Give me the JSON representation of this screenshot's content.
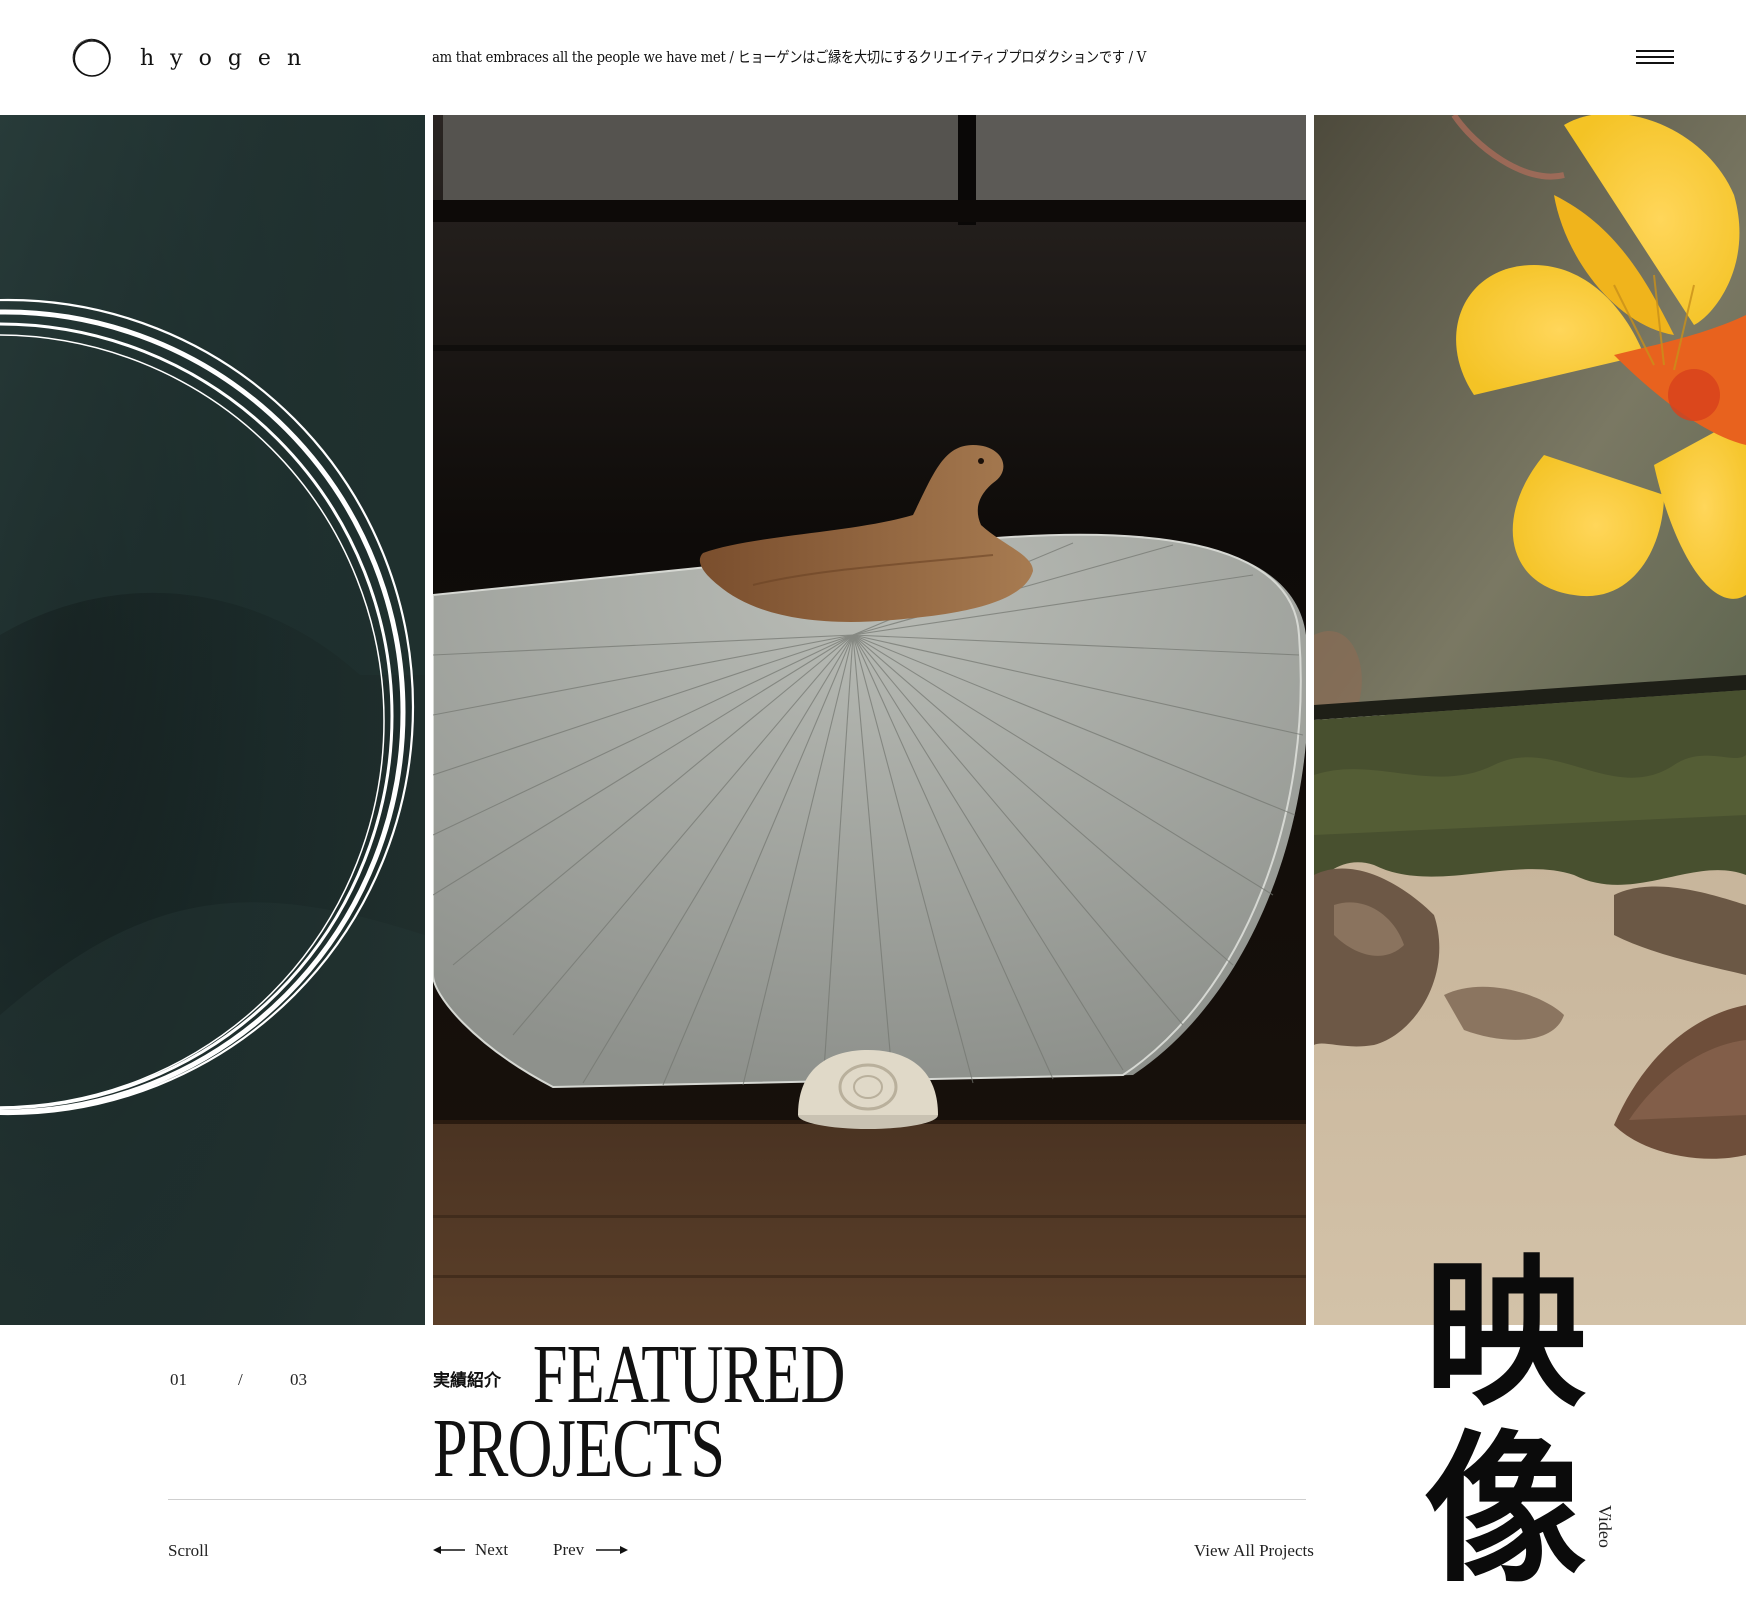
{
  "brand": {
    "name": "hyogen",
    "logo_icon": "ring-icon"
  },
  "ticker": {
    "text": "am that embraces all the people we have met / ヒョーゲンはご縁を大切にするクリエイティブプロダクションです / V"
  },
  "header": {
    "menu_icon": "hamburger-icon"
  },
  "slides": [
    {
      "name": "ring-slide",
      "bg": "#1b2a29"
    },
    {
      "name": "uchiwa-fan-slide",
      "bg": "#14100d"
    },
    {
      "name": "flower-beach-slide",
      "bg": "#6b6a55"
    }
  ],
  "pagination": {
    "current": "01",
    "separator": "/",
    "total": "03"
  },
  "section": {
    "label_ja": "実績紹介",
    "title_line1": "FEATURED",
    "title_line2": "PROJECTS"
  },
  "controls": {
    "scroll_label": "Scroll",
    "next_label": "Next",
    "prev_label": "Prev",
    "view_all_label": "View All Projects"
  },
  "category": {
    "kanji_1": "映",
    "kanji_2": "像",
    "english": "Video"
  }
}
